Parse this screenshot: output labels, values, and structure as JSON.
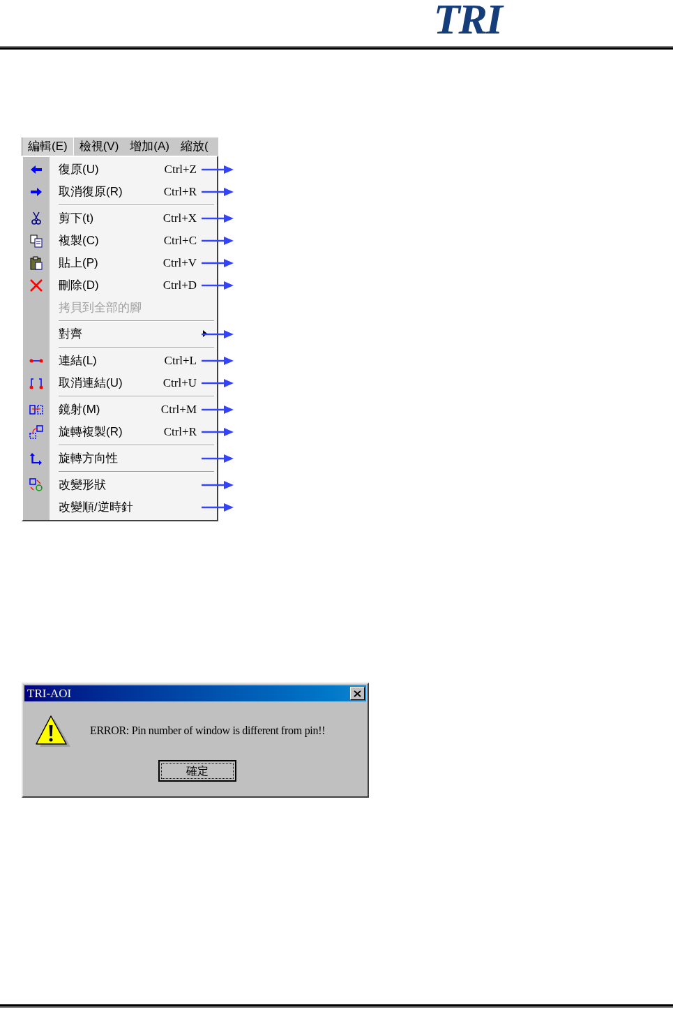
{
  "header": {
    "logo": "TRI"
  },
  "menu_bar": {
    "items": [
      {
        "label": "編輯(E)",
        "selected": true
      },
      {
        "label": "檢視(V)",
        "selected": false
      },
      {
        "label": "增加(A)",
        "selected": false
      },
      {
        "label": "縮放(",
        "selected": false
      }
    ]
  },
  "menu": {
    "items": [
      {
        "kind": "item",
        "label": "復原(U)",
        "shortcut": "Ctrl+Z",
        "disabled": false,
        "submenu": false,
        "arrow": true
      },
      {
        "kind": "item",
        "label": "取消復原(R)",
        "shortcut": "Ctrl+R",
        "disabled": false,
        "submenu": false,
        "arrow": true
      },
      {
        "kind": "separator"
      },
      {
        "kind": "item",
        "label": "剪下(t)",
        "shortcut": "Ctrl+X",
        "disabled": false,
        "submenu": false,
        "arrow": true
      },
      {
        "kind": "item",
        "label": "複製(C)",
        "shortcut": "Ctrl+C",
        "disabled": false,
        "submenu": false,
        "arrow": true
      },
      {
        "kind": "item",
        "label": "貼上(P)",
        "shortcut": "Ctrl+V",
        "disabled": false,
        "submenu": false,
        "arrow": true
      },
      {
        "kind": "item",
        "label": "刪除(D)",
        "shortcut": "Ctrl+D",
        "disabled": false,
        "submenu": false,
        "arrow": true
      },
      {
        "kind": "item",
        "label": "拷貝到全部的腳",
        "disabled": true,
        "submenu": false,
        "arrow": false
      },
      {
        "kind": "separator"
      },
      {
        "kind": "item",
        "label": "對齊",
        "disabled": false,
        "submenu": true,
        "arrow": true
      },
      {
        "kind": "separator"
      },
      {
        "kind": "item",
        "label": "連結(L)",
        "shortcut": "Ctrl+L",
        "disabled": false,
        "submenu": false,
        "arrow": true
      },
      {
        "kind": "item",
        "label": "取消連結(U)",
        "shortcut": "Ctrl+U",
        "disabled": false,
        "submenu": false,
        "arrow": true
      },
      {
        "kind": "separator"
      },
      {
        "kind": "item",
        "label": "鏡射(M)",
        "shortcut": "Ctrl+M",
        "disabled": false,
        "submenu": false,
        "arrow": true
      },
      {
        "kind": "item",
        "label": "旋轉複製(R)",
        "shortcut": "Ctrl+R",
        "disabled": false,
        "submenu": false,
        "arrow": true
      },
      {
        "kind": "separator"
      },
      {
        "kind": "item",
        "label": "旋轉方向性",
        "disabled": false,
        "submenu": false,
        "arrow": true
      },
      {
        "kind": "separator"
      },
      {
        "kind": "item",
        "label": "改變形狀",
        "disabled": false,
        "submenu": false,
        "arrow": true
      },
      {
        "kind": "item",
        "label": "改變順/逆時針",
        "disabled": false,
        "submenu": false,
        "arrow": true
      }
    ]
  },
  "dialog": {
    "title": "TRI-AOI",
    "message": "ERROR: Pin number of window is different from pin!!",
    "buttons": [
      "確定"
    ]
  }
}
